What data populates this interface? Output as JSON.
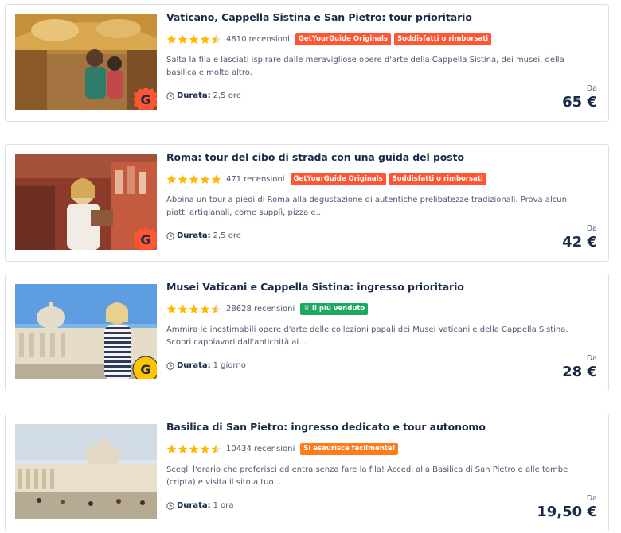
{
  "cards": [
    {
      "title": "Vaticano, Cappella Sistina e San Pietro: tour prioritario",
      "rating": 4.5,
      "reviews": "4810 recensioni",
      "tags": [
        {
          "text": "GetYourGuide Originals",
          "color": "#ff5533"
        },
        {
          "text": "Soddisfatti o rimborsati",
          "color": "#ff5533"
        }
      ],
      "description": "Salta la fila e lasciati ispirare dalle meravigliose opere d'arte della Cappella Sistina, dei musei, della basilica e molto altro.",
      "duration_label": "Durata:",
      "duration_value": "2,5 ore",
      "price_label": "Da",
      "price": "65 €",
      "badge": "originals-red"
    },
    {
      "title": "Roma: tour del cibo di strada con una guida del posto",
      "rating": 5,
      "reviews": "471 recensioni",
      "tags": [
        {
          "text": "GetYourGuide Originals",
          "color": "#ff5533"
        },
        {
          "text": "Soddisfatti o rimborsati",
          "color": "#ff5533"
        }
      ],
      "description": "Abbina un tour a piedi di Roma alla degustazione di autentiche prelibatezze tradizionali. Prova alcuni piatti artigianali, come supplì, pizza e...",
      "duration_label": "Durata:",
      "duration_value": "2,5 ore",
      "price_label": "Da",
      "price": "42 €",
      "badge": "originals-red"
    },
    {
      "title": "Musei Vaticani e Cappella Sistina: ingresso prioritario",
      "rating": 4.5,
      "reviews": "28628 recensioni",
      "tags": [
        {
          "text": "♕ Il più venduto",
          "color": "#1ba860"
        }
      ],
      "description": "Ammira le inestimabili opere d'arte delle collezioni papali dei Musei Vaticani e della Cappella Sistina. Scopri capolavori dall'antichità ai...",
      "duration_label": "Durata:",
      "duration_value": "1 giorno",
      "price_label": "Da",
      "price": "28 €",
      "badge": "originals-yellow"
    },
    {
      "title": "Basilica di San Pietro: ingresso dedicato e tour autonomo",
      "rating": 4.5,
      "reviews": "10434 recensioni",
      "tags": [
        {
          "text": "Si esaurisce facilmente!",
          "color": "#ff7b1c"
        }
      ],
      "description": "Scegli l'orario che preferisci ed entra senza fare la fila! Accedi alla Basilica di San Pietro e alle tombe (cripta) e visita il sito a tuo...",
      "duration_label": "Durata:",
      "duration_value": "1 ora",
      "price_label": "Da",
      "price": "19,50 €",
      "badge": "none"
    }
  ],
  "colors": {
    "star": "#ffb800",
    "text_dark": "#1a2b49",
    "text_muted": "#4d5a70",
    "originals_red": "#ff5533"
  }
}
